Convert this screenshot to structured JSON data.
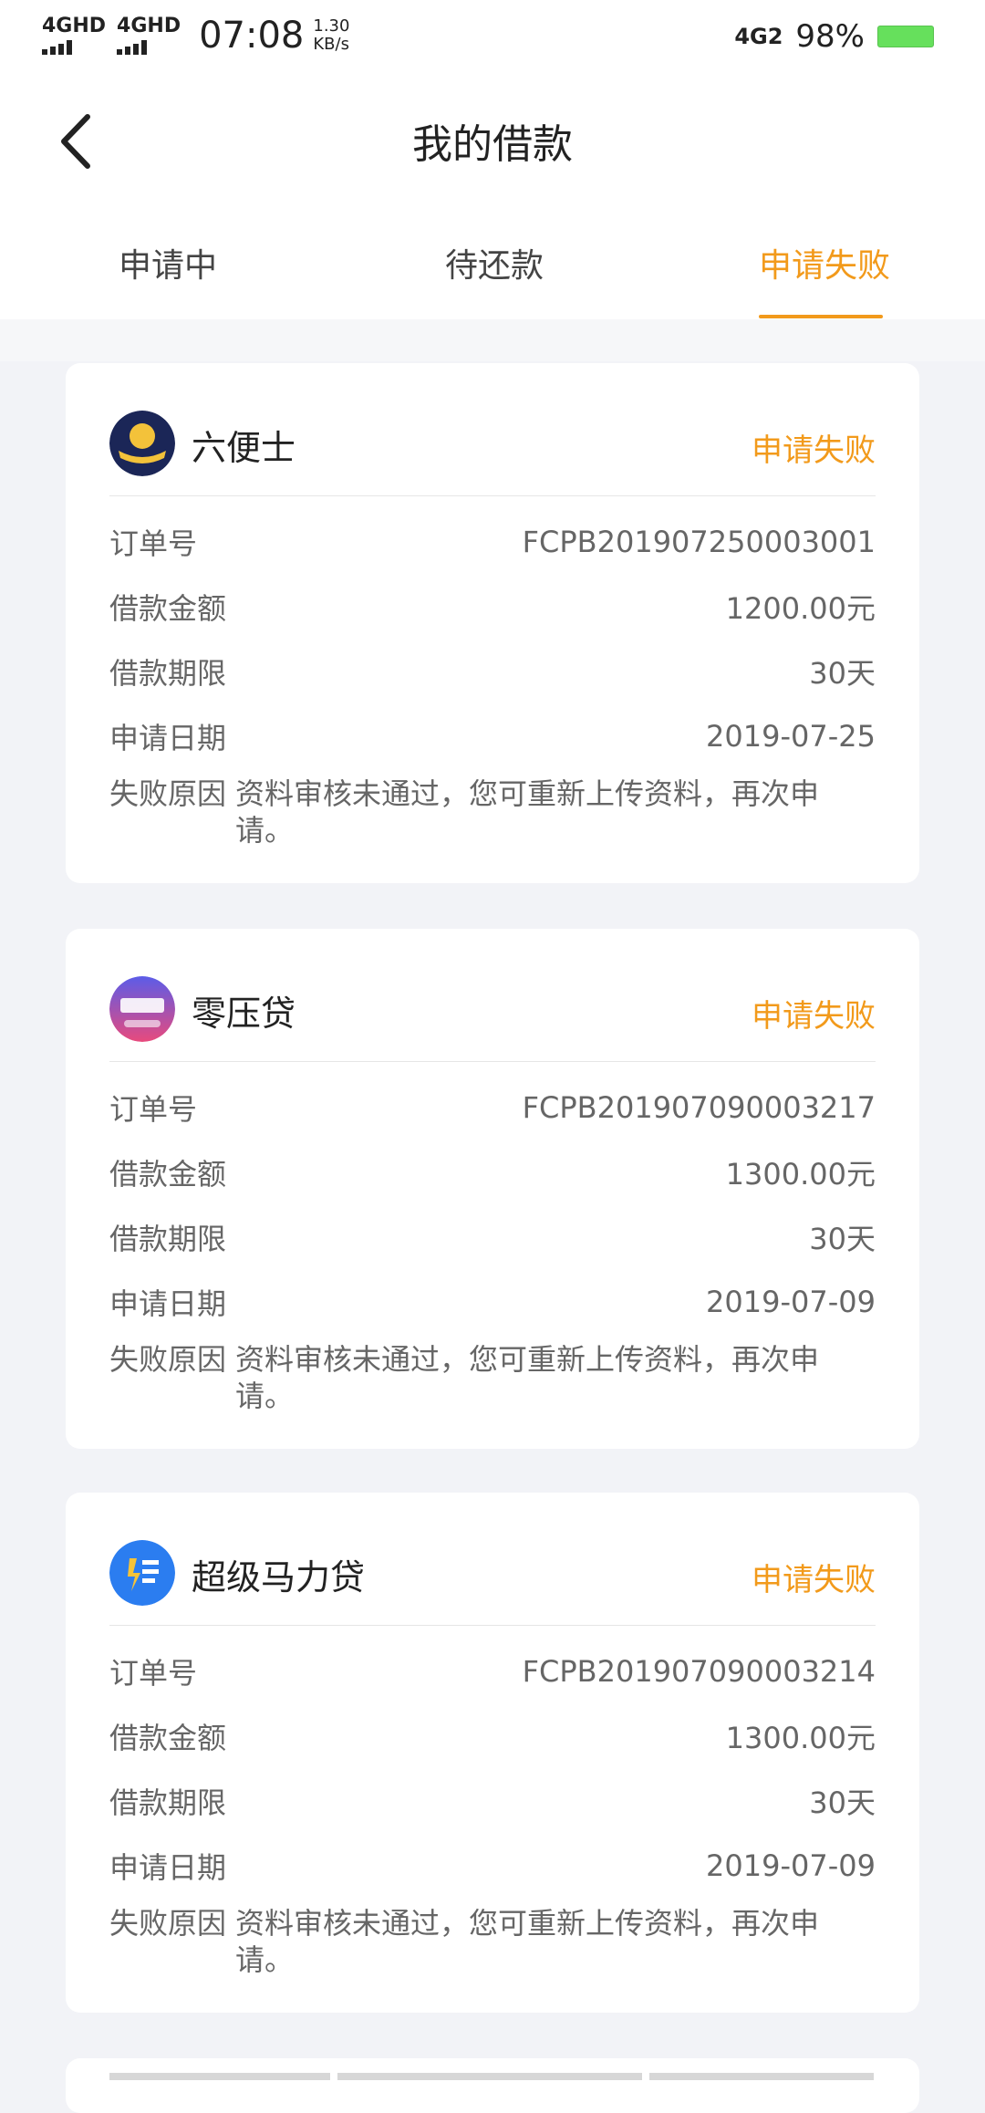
{
  "status_bar": {
    "network1": "4GHD",
    "network2": "4GHD",
    "time": "07:08",
    "speed_value": "1.30",
    "speed_unit": "KB/s",
    "network_type": "4G2",
    "battery": "98%"
  },
  "header": {
    "title": "我的借款"
  },
  "tabs": [
    {
      "label": "申请中"
    },
    {
      "label": "待还款"
    },
    {
      "label": "申请失败"
    }
  ],
  "orders": [
    {
      "name": "六便士",
      "status": "申请失败",
      "order_label": "订单号",
      "order_no": "FCPB201907250003001",
      "amount_label": "借款金额",
      "amount": "1200.00元",
      "term_label": "借款期限",
      "term": "30天",
      "date_label": "申请日期",
      "date": "2019-07-25",
      "reason_label": "失败原因",
      "reason": "资料审核未通过，您可重新上传资料，再次申请。"
    },
    {
      "name": "零压贷",
      "status": "申请失败",
      "order_label": "订单号",
      "order_no": "FCPB201907090003217",
      "amount_label": "借款金额",
      "amount": "1300.00元",
      "term_label": "借款期限",
      "term": "30天",
      "date_label": "申请日期",
      "date": "2019-07-09",
      "reason_label": "失败原因",
      "reason": "资料审核未通过，您可重新上传资料，再次申请。"
    },
    {
      "name": "超级马力贷",
      "status": "申请失败",
      "order_label": "订单号",
      "order_no": "FCPB201907090003214",
      "amount_label": "借款金额",
      "amount": "1300.00元",
      "term_label": "借款期限",
      "term": "30天",
      "date_label": "申请日期",
      "date": "2019-07-09",
      "reason_label": "失败原因",
      "reason": "资料审核未通过，您可重新上传资料，再次申请。"
    }
  ],
  "colors": {
    "accent": "#f29a1b",
    "background": "#f2f3f7"
  },
  "icons": {
    "back": "chevron-left-icon"
  }
}
